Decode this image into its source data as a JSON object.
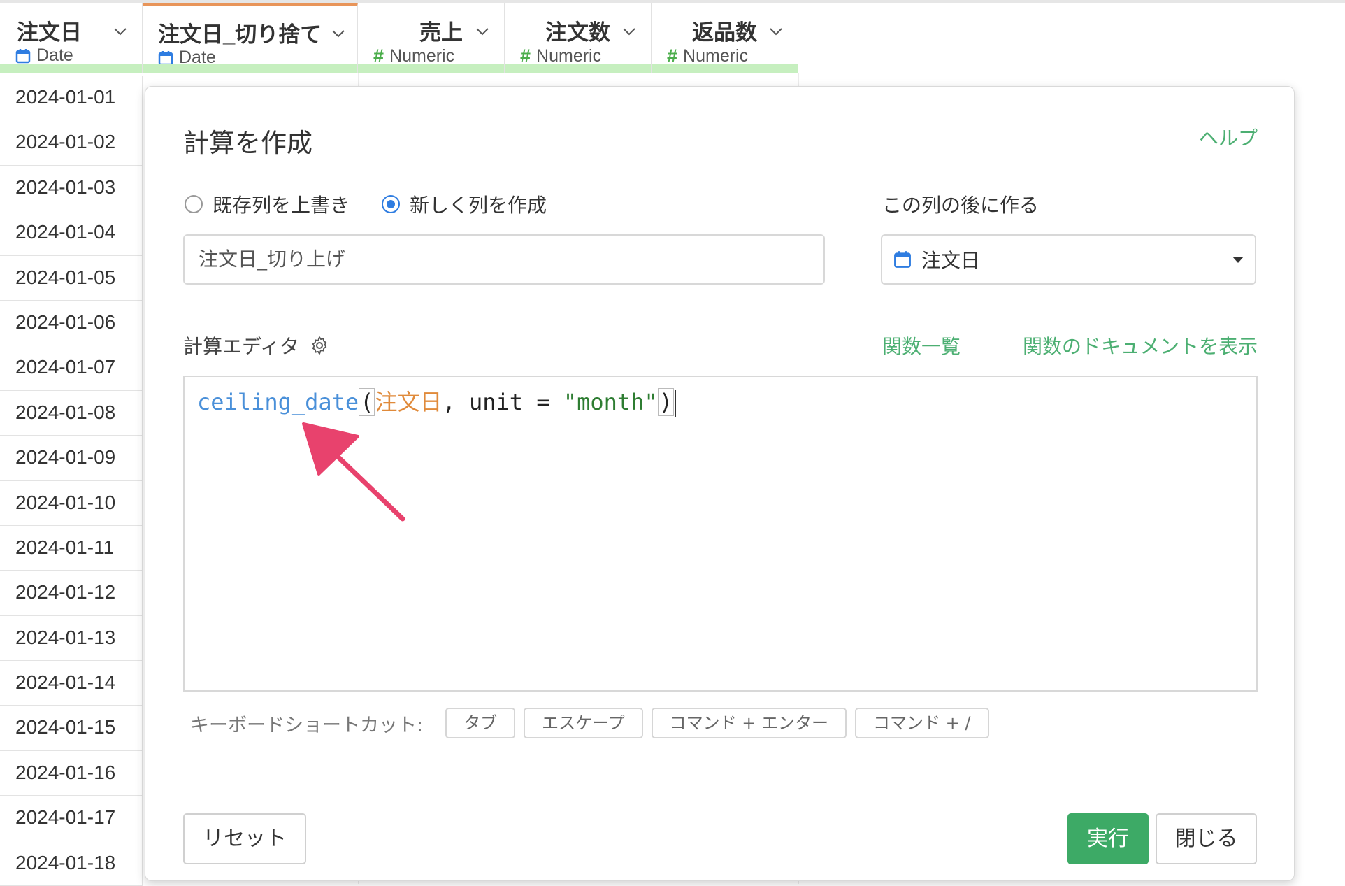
{
  "grid": {
    "columns": [
      {
        "name": "注文日",
        "type": "Date",
        "type_icon": "calendar-icon"
      },
      {
        "name": "注文日_切り捨て",
        "type": "Date",
        "type_icon": "calendar-icon"
      },
      {
        "name": "売上",
        "type": "Numeric",
        "type_icon": "#"
      },
      {
        "name": "注文数",
        "type": "Numeric",
        "type_icon": "#"
      },
      {
        "name": "返品数",
        "type": "Numeric",
        "type_icon": "#"
      }
    ],
    "rows": [
      "2024-01-01",
      "2024-01-02",
      "2024-01-03",
      "2024-01-04",
      "2024-01-05",
      "2024-01-06",
      "2024-01-07",
      "2024-01-08",
      "2024-01-09",
      "2024-01-10",
      "2024-01-11",
      "2024-01-12",
      "2024-01-13",
      "2024-01-14",
      "2024-01-15",
      "2024-01-16",
      "2024-01-17",
      "2024-01-18"
    ]
  },
  "dialog": {
    "title": "計算を作成",
    "help": "ヘルプ",
    "radio_overwrite": "既存列を上書き",
    "radio_new": "新しく列を作成",
    "radio_selected": "new",
    "after_label": "この列の後に作る",
    "new_column_name": "注文日_切り上げ",
    "after_column": "注文日",
    "editor_label": "計算エディタ",
    "function_list": "関数一覧",
    "function_docs": "関数のドキュメントを表示",
    "code": {
      "fn": "ceiling_date",
      "open": "(",
      "col": "注文日",
      "mid": ", unit = ",
      "str": "\"month\"",
      "close": ")"
    },
    "shortcut_label": "キーボードショートカット:",
    "shortcuts": [
      "タブ",
      "エスケープ",
      "コマンド + エンター",
      "コマンド + /"
    ],
    "reset": "リセット",
    "run": "実行",
    "close": "閉じる"
  },
  "colors": {
    "accent_green": "#4caf72",
    "run_button": "#3daa66",
    "function_token": "#4a90d9",
    "column_token": "#e08a3a",
    "string_token": "#2e7d32",
    "annotation_arrow": "#e8426d",
    "active_column_top": "#e8955a",
    "column_quality_bar": "#c6efbf"
  }
}
